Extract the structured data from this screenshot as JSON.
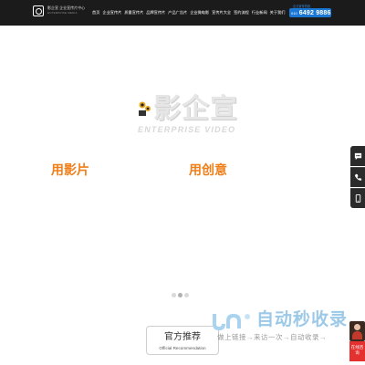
{
  "header": {
    "logo_text": "影企宣 企业宣传片中心",
    "logo_sub": "ENTERPRISE MEDIA",
    "nav": [
      "首页",
      "企业宣传片",
      "质量宣传片",
      "品牌宣传片",
      "产品广告片",
      "企业微电影",
      "宣传片大全",
      "签约流程",
      "行业新闻",
      "关于我们"
    ],
    "hotline_label": "企业宣传热线",
    "hotline_area": "010",
    "hotline_number": "6492 9886"
  },
  "hero": {
    "logo_cn": "影企宣",
    "logo_en": "ENTERPRISE VIDEO",
    "slogan_left": "用影片",
    "slogan_right": "用创意",
    "slide_count": 3,
    "active_slide": 2
  },
  "side_tools": [
    "chat-icon",
    "phone-icon",
    "mobile-icon"
  ],
  "recommend": {
    "title_cn": "官方推荐",
    "title_en": "Official Recommendation"
  },
  "watermark": {
    "title": "自动秒收录",
    "subtitle": "做上链接→来访一次→自动收录→"
  },
  "promo": {
    "label": "在线咨询"
  },
  "colors": {
    "header_bg": "#1b1b1b",
    "accent_blue": "#1a77d4",
    "slogan_orange": "#f07f1a",
    "side_tool_bg": "#2b2b2b",
    "promo_red": "#e53030"
  }
}
